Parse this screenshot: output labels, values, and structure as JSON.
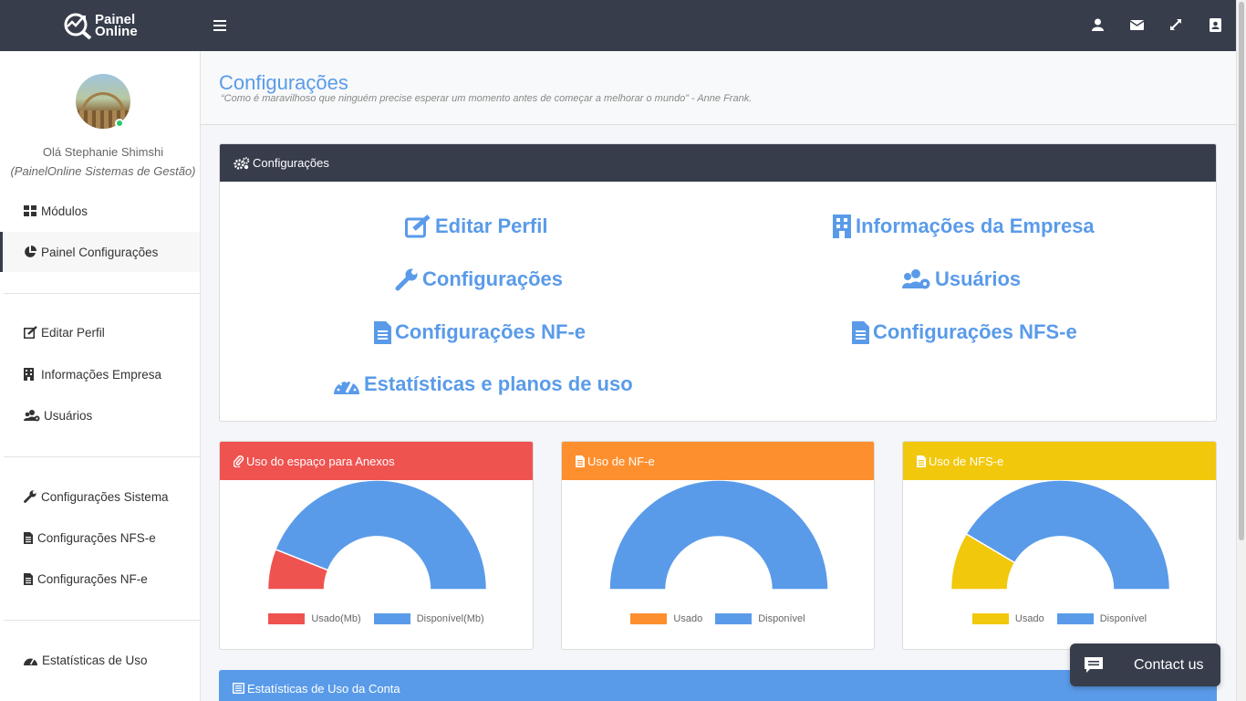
{
  "topbar": {
    "logo_line1": "Painel",
    "logo_line2": "Online",
    "icons": [
      "menu-icon",
      "user-icon",
      "envelope-icon",
      "expand-icon",
      "address-book-icon"
    ]
  },
  "sidebar": {
    "greeting": "Olá Stephanie Shimshi",
    "company": "(PainelOnline Sistemas de Gestão)",
    "items": [
      {
        "label": "Módulos",
        "icon": "th-large-icon"
      },
      {
        "label": "Painel Configurações",
        "icon": "pie-chart-icon"
      },
      {
        "label": "Editar Perfil",
        "icon": "edit-icon"
      },
      {
        "label": "Informações Empresa",
        "icon": "building-icon"
      },
      {
        "label": "Usuários",
        "icon": "users-cog-icon"
      },
      {
        "label": "Configurações Sistema",
        "icon": "wrench-icon"
      },
      {
        "label": "Configurações NFS-e",
        "icon": "file-icon"
      },
      {
        "label": "Configurações NF-e",
        "icon": "file-icon"
      },
      {
        "label": "Estatísticas de Uso",
        "icon": "gauge-icon"
      }
    ]
  },
  "header": {
    "title": "Configurações",
    "quote": "“Como é maravilhoso que ninguém precise esperar um momento antes de começar a melhorar o mundo” - Anne Frank."
  },
  "config_card": {
    "title": "Configurações",
    "links": [
      {
        "label": "Editar Perfil",
        "icon": "edit-icon"
      },
      {
        "label": "Informações da Empresa",
        "icon": "building-icon"
      },
      {
        "label": "Configurações",
        "icon": "wrench-icon"
      },
      {
        "label": "Usuários",
        "icon": "users-cog-icon"
      },
      {
        "label": "Configurações NF-e",
        "icon": "file-icon"
      },
      {
        "label": "Configurações NFS-e",
        "icon": "file-icon"
      },
      {
        "label": "Estatísticas e planos de uso",
        "icon": "gauge-icon"
      }
    ]
  },
  "colors": {
    "dark": "#373d4b",
    "accent": "#5a9be9",
    "red": "#ef5350",
    "orange": "#fd8f2e",
    "yellow": "#f2c80c"
  },
  "chart_data": [
    {
      "type": "pie",
      "title": "Uso do espaço para Anexos",
      "labels": [
        "Usado(Mb)",
        "Disponível(Mb)"
      ],
      "values": [
        12,
        88
      ],
      "colors": [
        "#ef5350",
        "#5a9be9"
      ]
    },
    {
      "type": "pie",
      "title": "Uso de NF-e",
      "labels": [
        "Usado",
        "Disponível"
      ],
      "values": [
        0,
        100
      ],
      "colors": [
        "#fd8f2e",
        "#5a9be9"
      ]
    },
    {
      "type": "pie",
      "title": "Uso de NFS-e",
      "labels": [
        "Usado",
        "Disponível"
      ],
      "values": [
        17,
        83
      ],
      "colors": [
        "#f2c80c",
        "#5a9be9"
      ]
    }
  ],
  "stats_card": {
    "title": "Estatísticas de Uso da Conta"
  },
  "contact": {
    "label": "Contact us"
  }
}
